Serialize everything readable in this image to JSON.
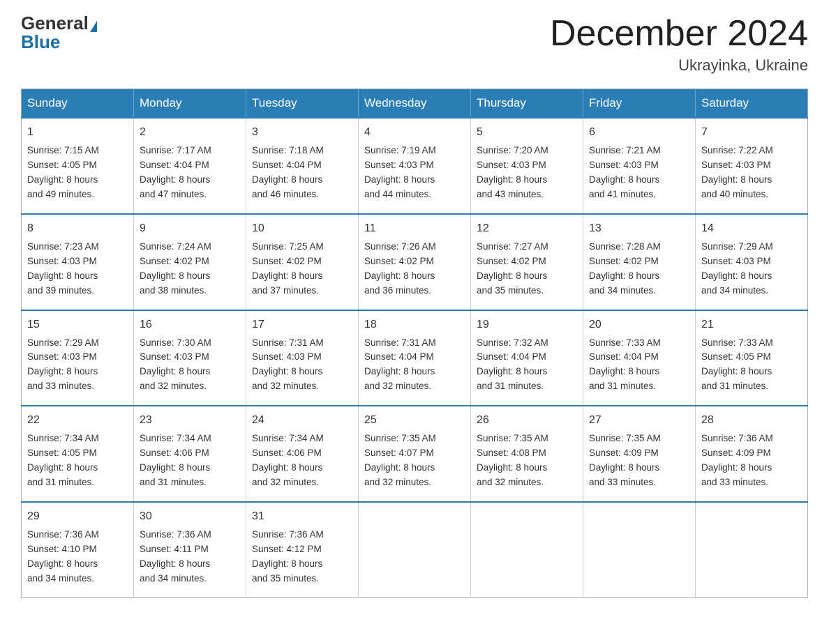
{
  "logo": {
    "general": "General",
    "blue": "Blue"
  },
  "title": "December 2024",
  "location": "Ukrayinka, Ukraine",
  "days_of_week": [
    "Sunday",
    "Monday",
    "Tuesday",
    "Wednesday",
    "Thursday",
    "Friday",
    "Saturday"
  ],
  "weeks": [
    [
      {
        "day": "1",
        "info": "Sunrise: 7:15 AM\nSunset: 4:05 PM\nDaylight: 8 hours\nand 49 minutes."
      },
      {
        "day": "2",
        "info": "Sunrise: 7:17 AM\nSunset: 4:04 PM\nDaylight: 8 hours\nand 47 minutes."
      },
      {
        "day": "3",
        "info": "Sunrise: 7:18 AM\nSunset: 4:04 PM\nDaylight: 8 hours\nand 46 minutes."
      },
      {
        "day": "4",
        "info": "Sunrise: 7:19 AM\nSunset: 4:03 PM\nDaylight: 8 hours\nand 44 minutes."
      },
      {
        "day": "5",
        "info": "Sunrise: 7:20 AM\nSunset: 4:03 PM\nDaylight: 8 hours\nand 43 minutes."
      },
      {
        "day": "6",
        "info": "Sunrise: 7:21 AM\nSunset: 4:03 PM\nDaylight: 8 hours\nand 41 minutes."
      },
      {
        "day": "7",
        "info": "Sunrise: 7:22 AM\nSunset: 4:03 PM\nDaylight: 8 hours\nand 40 minutes."
      }
    ],
    [
      {
        "day": "8",
        "info": "Sunrise: 7:23 AM\nSunset: 4:03 PM\nDaylight: 8 hours\nand 39 minutes."
      },
      {
        "day": "9",
        "info": "Sunrise: 7:24 AM\nSunset: 4:02 PM\nDaylight: 8 hours\nand 38 minutes."
      },
      {
        "day": "10",
        "info": "Sunrise: 7:25 AM\nSunset: 4:02 PM\nDaylight: 8 hours\nand 37 minutes."
      },
      {
        "day": "11",
        "info": "Sunrise: 7:26 AM\nSunset: 4:02 PM\nDaylight: 8 hours\nand 36 minutes."
      },
      {
        "day": "12",
        "info": "Sunrise: 7:27 AM\nSunset: 4:02 PM\nDaylight: 8 hours\nand 35 minutes."
      },
      {
        "day": "13",
        "info": "Sunrise: 7:28 AM\nSunset: 4:02 PM\nDaylight: 8 hours\nand 34 minutes."
      },
      {
        "day": "14",
        "info": "Sunrise: 7:29 AM\nSunset: 4:03 PM\nDaylight: 8 hours\nand 34 minutes."
      }
    ],
    [
      {
        "day": "15",
        "info": "Sunrise: 7:29 AM\nSunset: 4:03 PM\nDaylight: 8 hours\nand 33 minutes."
      },
      {
        "day": "16",
        "info": "Sunrise: 7:30 AM\nSunset: 4:03 PM\nDaylight: 8 hours\nand 32 minutes."
      },
      {
        "day": "17",
        "info": "Sunrise: 7:31 AM\nSunset: 4:03 PM\nDaylight: 8 hours\nand 32 minutes."
      },
      {
        "day": "18",
        "info": "Sunrise: 7:31 AM\nSunset: 4:04 PM\nDaylight: 8 hours\nand 32 minutes."
      },
      {
        "day": "19",
        "info": "Sunrise: 7:32 AM\nSunset: 4:04 PM\nDaylight: 8 hours\nand 31 minutes."
      },
      {
        "day": "20",
        "info": "Sunrise: 7:33 AM\nSunset: 4:04 PM\nDaylight: 8 hours\nand 31 minutes."
      },
      {
        "day": "21",
        "info": "Sunrise: 7:33 AM\nSunset: 4:05 PM\nDaylight: 8 hours\nand 31 minutes."
      }
    ],
    [
      {
        "day": "22",
        "info": "Sunrise: 7:34 AM\nSunset: 4:05 PM\nDaylight: 8 hours\nand 31 minutes."
      },
      {
        "day": "23",
        "info": "Sunrise: 7:34 AM\nSunset: 4:06 PM\nDaylight: 8 hours\nand 31 minutes."
      },
      {
        "day": "24",
        "info": "Sunrise: 7:34 AM\nSunset: 4:06 PM\nDaylight: 8 hours\nand 32 minutes."
      },
      {
        "day": "25",
        "info": "Sunrise: 7:35 AM\nSunset: 4:07 PM\nDaylight: 8 hours\nand 32 minutes."
      },
      {
        "day": "26",
        "info": "Sunrise: 7:35 AM\nSunset: 4:08 PM\nDaylight: 8 hours\nand 32 minutes."
      },
      {
        "day": "27",
        "info": "Sunrise: 7:35 AM\nSunset: 4:09 PM\nDaylight: 8 hours\nand 33 minutes."
      },
      {
        "day": "28",
        "info": "Sunrise: 7:36 AM\nSunset: 4:09 PM\nDaylight: 8 hours\nand 33 minutes."
      }
    ],
    [
      {
        "day": "29",
        "info": "Sunrise: 7:36 AM\nSunset: 4:10 PM\nDaylight: 8 hours\nand 34 minutes."
      },
      {
        "day": "30",
        "info": "Sunrise: 7:36 AM\nSunset: 4:11 PM\nDaylight: 8 hours\nand 34 minutes."
      },
      {
        "day": "31",
        "info": "Sunrise: 7:36 AM\nSunset: 4:12 PM\nDaylight: 8 hours\nand 35 minutes."
      },
      null,
      null,
      null,
      null
    ]
  ]
}
